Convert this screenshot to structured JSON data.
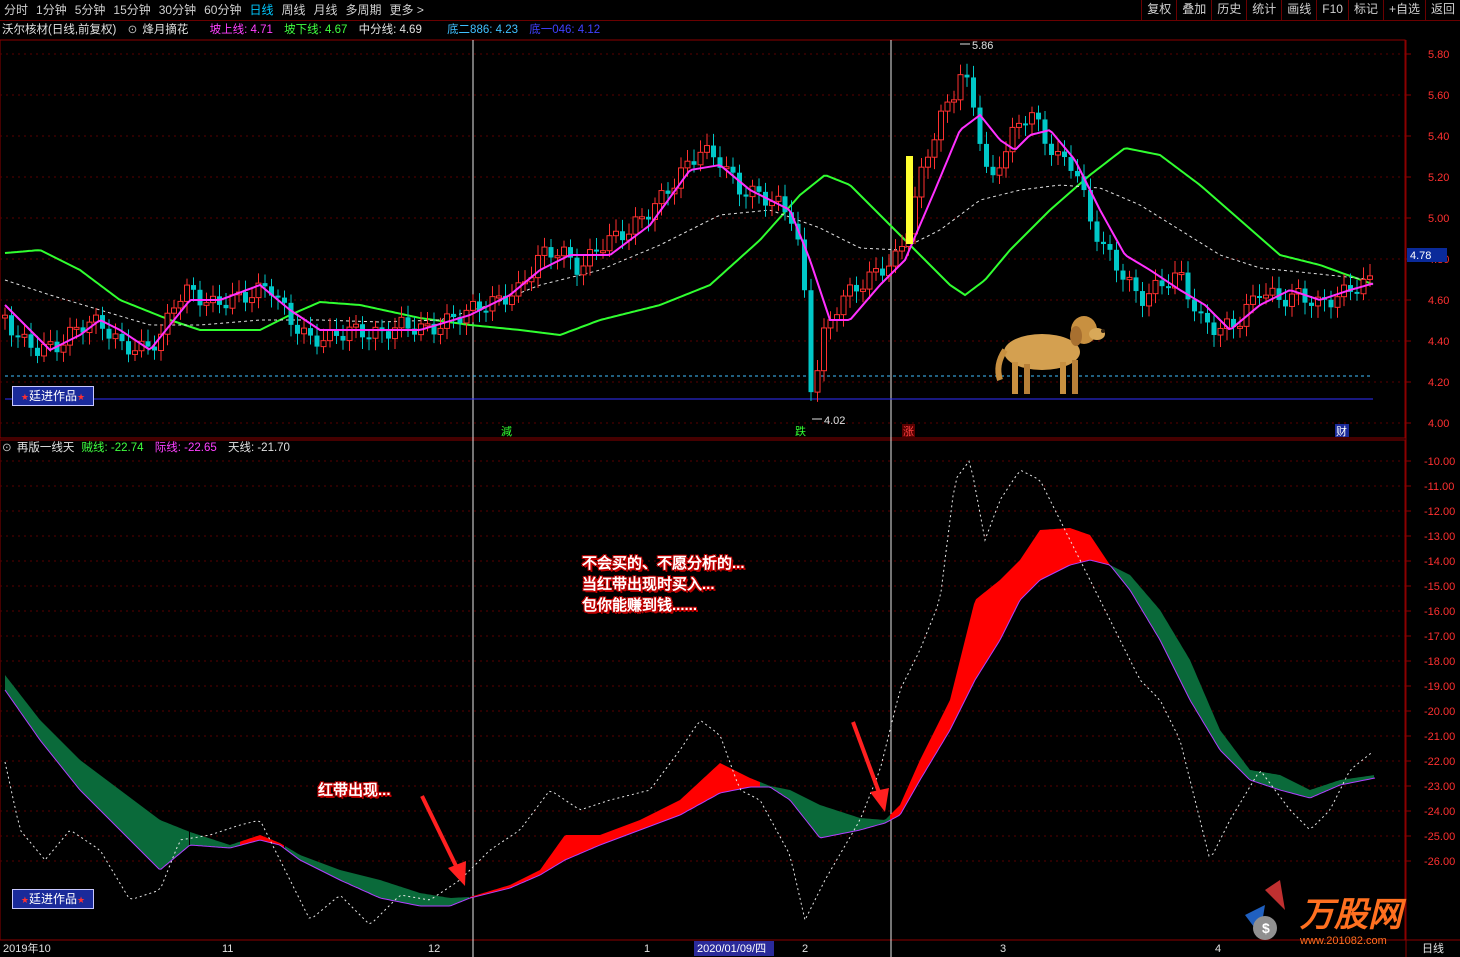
{
  "toolbar": {
    "periods": [
      "分时",
      "1分钟",
      "5分钟",
      "15分钟",
      "30分钟",
      "60分钟",
      "日线",
      "周线",
      "月线",
      "多周期",
      "更多 >"
    ],
    "active_period": "日线",
    "right_buttons": [
      "复权",
      "叠加",
      "历史",
      "统计",
      "画线",
      "F10",
      "标记",
      "+自选",
      "返回"
    ]
  },
  "main_panel": {
    "stock_title": "沃尔核材(日线,前复权)",
    "indicator_name": "烽月摘花",
    "lines": [
      {
        "label": "坡上线: 4.71",
        "color": "#ff40ff"
      },
      {
        "label": "坡下线: 4.67",
        "color": "#40ff40"
      },
      {
        "label": "中分线: 4.69",
        "color": "#e0e0e0"
      },
      {
        "label": "底二886: 4.23",
        "color": "#40c0ff"
      },
      {
        "label": "底一046: 4.12",
        "color": "#4040ff"
      }
    ],
    "price_ticks": [
      "5.80",
      "5.60",
      "5.40",
      "5.20",
      "5.00",
      "4.80",
      "4.60",
      "4.40",
      "4.20",
      "4.00"
    ],
    "current_price": "4.78",
    "high_label": "5.86",
    "low_label": "4.02",
    "markers": [
      "減",
      "跌",
      "涨",
      "财"
    ],
    "badge": "廷进作品"
  },
  "sub_panel": {
    "indicator_name": "再版一线天",
    "lines": [
      {
        "label": "贼线: -22.74",
        "color": "#40ff40"
      },
      {
        "label": "际线: -22.65",
        "color": "#ff40ff"
      },
      {
        "label": "天线: -21.70",
        "color": "#e0e0e0"
      }
    ],
    "ticks": [
      "-10.00",
      "-11.00",
      "-12.00",
      "-13.00",
      "-14.00",
      "-15.00",
      "-16.00",
      "-17.00",
      "-18.00",
      "-19.00",
      "-20.00",
      "-21.00",
      "-22.00",
      "-23.00",
      "-24.00",
      "-25.00",
      "-26.00"
    ],
    "badge": "廷进作品",
    "callout_1": "红带出现...",
    "callout_2": [
      "不会买的、不愿分析的...",
      "当红带出现时买入...",
      "包你能赚到钱......"
    ]
  },
  "time_axis": {
    "labels": [
      "2019年10",
      "11",
      "12",
      "1",
      "2020/01/09/四",
      "2",
      "3",
      "4"
    ],
    "period_label": "日线"
  },
  "watermark": {
    "brand": "万股网",
    "url": "www.201082.com"
  },
  "colors": {
    "up": "#ff3030",
    "down": "#00c8c8",
    "red_band": "#ff0000",
    "green_band": "#0a6a3a",
    "frame": "#8b0000"
  }
}
